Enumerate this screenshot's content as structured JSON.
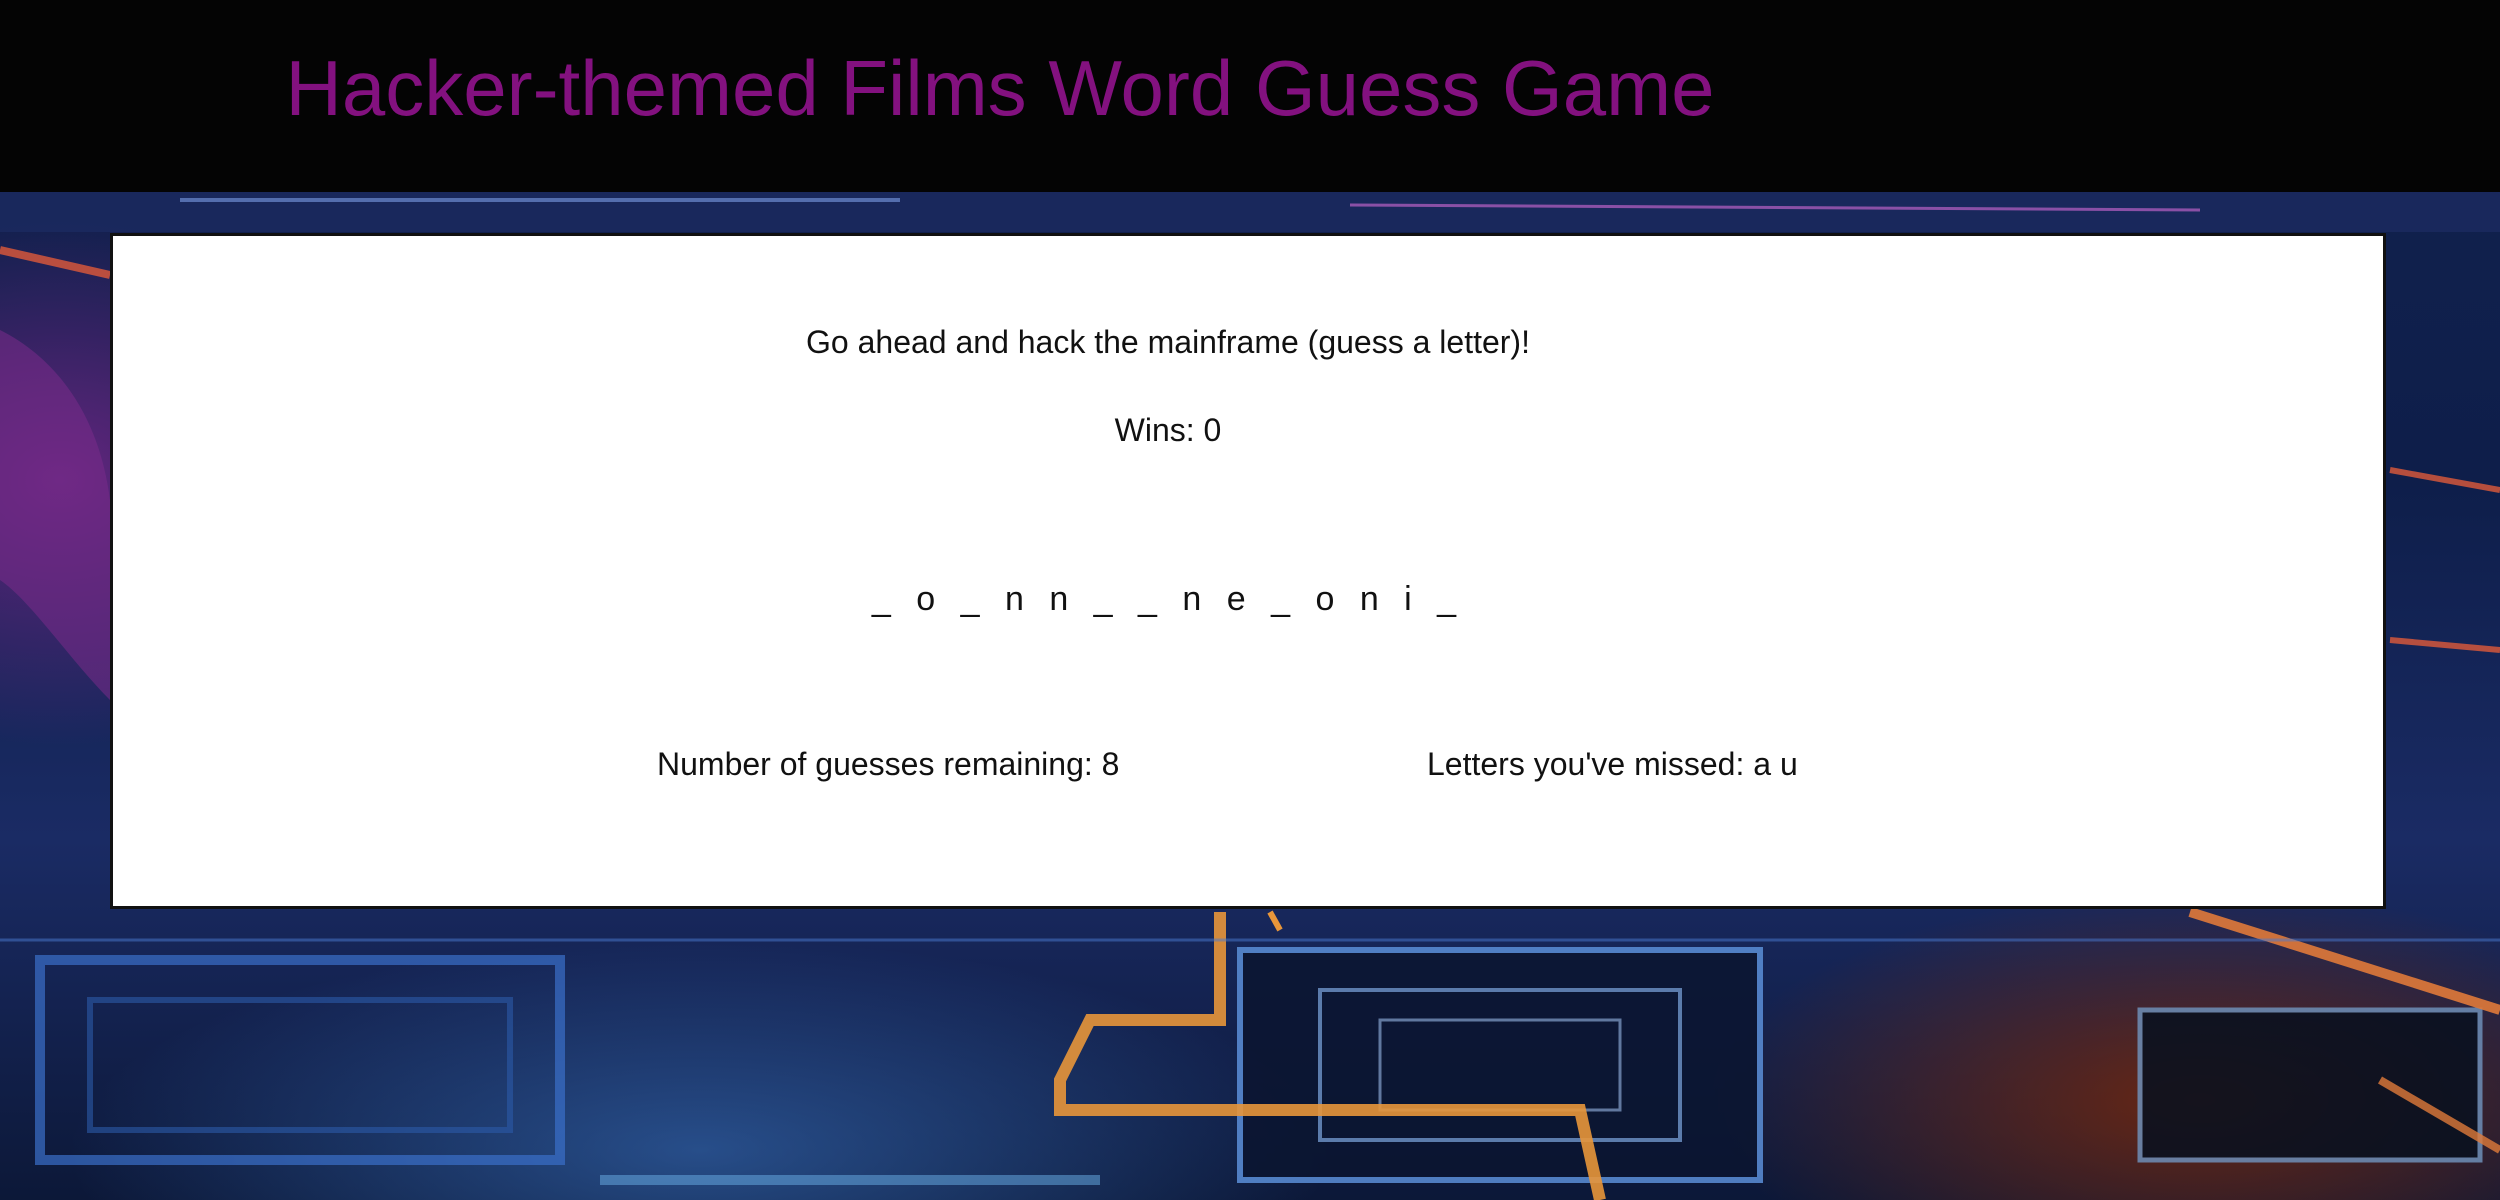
{
  "header": {
    "title": "Hacker-themed Films Word Guess Game"
  },
  "game": {
    "prompt": "Go ahead and hack the mainframe (guess a letter)!",
    "wins_label": "Wins: ",
    "wins_value": "0",
    "word_display": "_ o _ n n _ _ n e _ o n i _",
    "remaining_label": "Number of guesses remaining: ",
    "remaining_value": "8",
    "missed_label": "Letters you've missed: ",
    "missed_value": "a u"
  },
  "colors": {
    "title": "#83117f",
    "header_bg": "#040404",
    "panel_bg": "#ffffff",
    "text": "#111111"
  },
  "icons": {
    "background": "circuit-board-background-image"
  }
}
